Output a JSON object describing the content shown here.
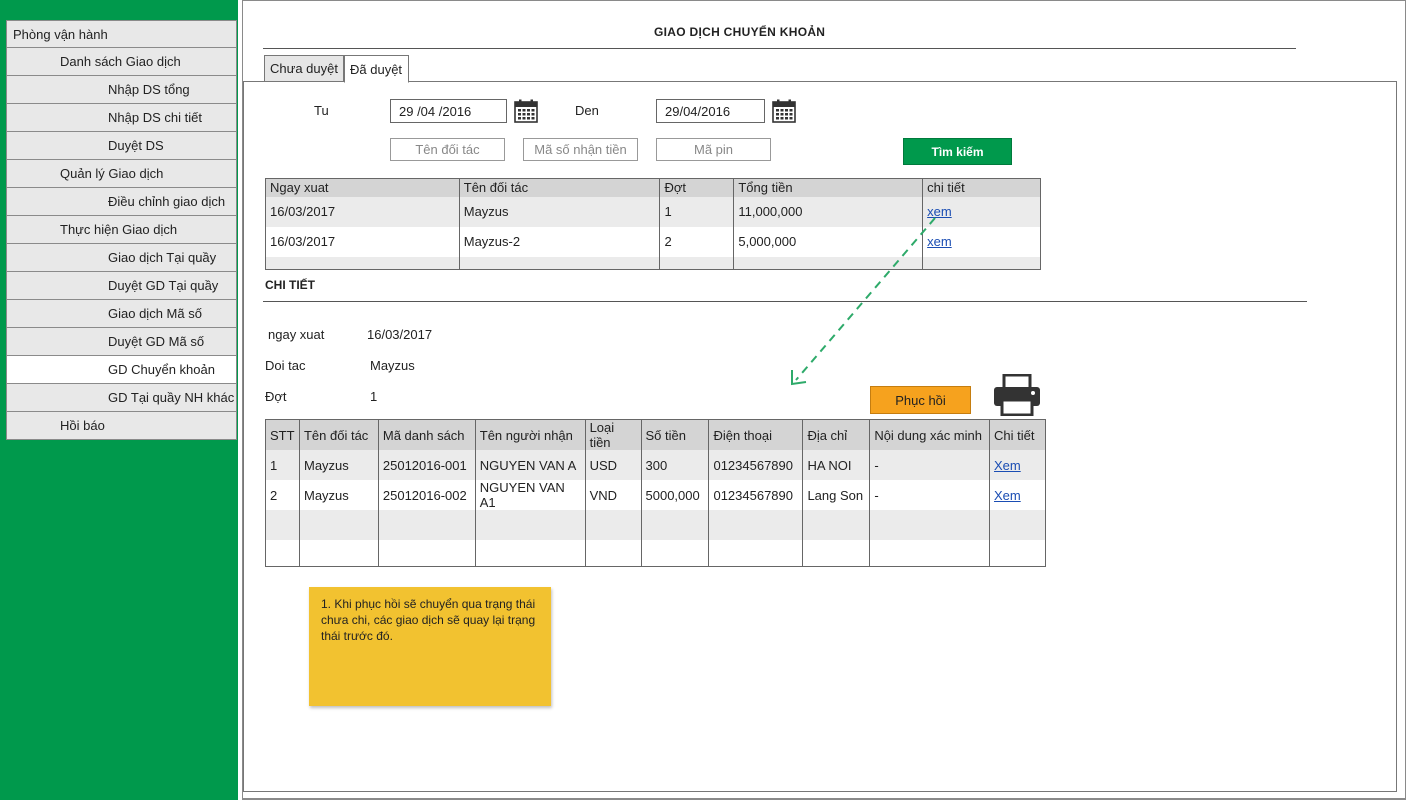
{
  "sidebar": {
    "items": [
      {
        "label": "Phòng vận hành",
        "level": 0
      },
      {
        "label": "Danh sách Giao dịch",
        "level": 1
      },
      {
        "label": "Nhập DS tổng",
        "level": 2
      },
      {
        "label": "Nhập DS chi tiết",
        "level": 2
      },
      {
        "label": "Duyệt DS",
        "level": 2
      },
      {
        "label": "Quản lý Giao dịch",
        "level": 1
      },
      {
        "label": "Điều chỉnh giao dịch",
        "level": 2
      },
      {
        "label": "Thực hiện Giao dịch",
        "level": 1
      },
      {
        "label": "Giao dịch Tại quầy",
        "level": 2
      },
      {
        "label": "Duyệt GD Tại quầy",
        "level": 2
      },
      {
        "label": "Giao dịch Mã số",
        "level": 2
      },
      {
        "label": "Duyệt GD Mã số",
        "level": 2
      },
      {
        "label": "GD Chuyển khoản",
        "level": 2,
        "active": true
      },
      {
        "label": "GD Tại quầy NH khác",
        "level": 2
      },
      {
        "label": "Hồi báo",
        "level": 1
      }
    ]
  },
  "header": {
    "title": "GIAO DỊCH CHUYỂN KHOẢN"
  },
  "tabs": [
    {
      "label": "Chưa duyệt"
    },
    {
      "label": "Đã duyệt"
    }
  ],
  "filter": {
    "from_label": "Tu",
    "from_value": "29 /04 /2016",
    "to_label": "Den",
    "to_value": "29/04/2016",
    "partner_placeholder": "Tên đối tác",
    "receiver_code_placeholder": "Mã số nhận tiền",
    "pin_placeholder": "Mã pin",
    "search_label": "Tìm kiếm"
  },
  "summary_table": {
    "headers": [
      "Ngay xuat",
      "Tên đối tác",
      "Đợt",
      "Tổng tiền",
      "chi tiết"
    ],
    "rows": [
      [
        "16/03/2017",
        "Mayzus",
        "1",
        "11,000,000",
        "xem"
      ],
      [
        "16/03/2017",
        "Mayzus-2",
        "2",
        "5,000,000",
        "xem"
      ]
    ]
  },
  "detail": {
    "section_title": "CHI TIẾT",
    "date_label": "ngay xuat",
    "date_value": "16/03/2017",
    "partner_label": "Doi tac",
    "partner_value": "Mayzus",
    "batch_label": "Đợt",
    "batch_value": "1",
    "restore_label": "Phục hồi"
  },
  "detail_table": {
    "headers": [
      "STT",
      "Tên đối tác",
      "Mã danh sách",
      "Tên người nhận",
      "Loại tiền",
      "Số tiền",
      "Điện thoại",
      "Địa chỉ",
      "Nội dung xác minh",
      "Chi tiết"
    ],
    "rows": [
      [
        "1",
        "Mayzus",
        "25012016-001",
        "NGUYEN VAN A",
        "USD",
        "300",
        "01234567890",
        "HA NOI",
        "-",
        "Xem"
      ],
      [
        "2",
        "Mayzus",
        "25012016-002",
        "NGUYEN VAN A1",
        "VND",
        "5000,000",
        "01234567890",
        "Lang Son",
        "-",
        "Xem"
      ]
    ]
  },
  "note": {
    "text": "1. Khi phục hồi sẽ chuyển qua trạng thái chưa chi, các giao dịch sẽ quay lại trạng thái trước đó."
  },
  "colors": {
    "sidebar_bg": "#00994c",
    "search_button": "#00994c",
    "restore_button": "#f6a21e",
    "note_bg": "#f2c230",
    "arrow": "#2eaa6a"
  },
  "icons": {
    "calendar": "calendar-icon",
    "printer": "printer-icon"
  }
}
